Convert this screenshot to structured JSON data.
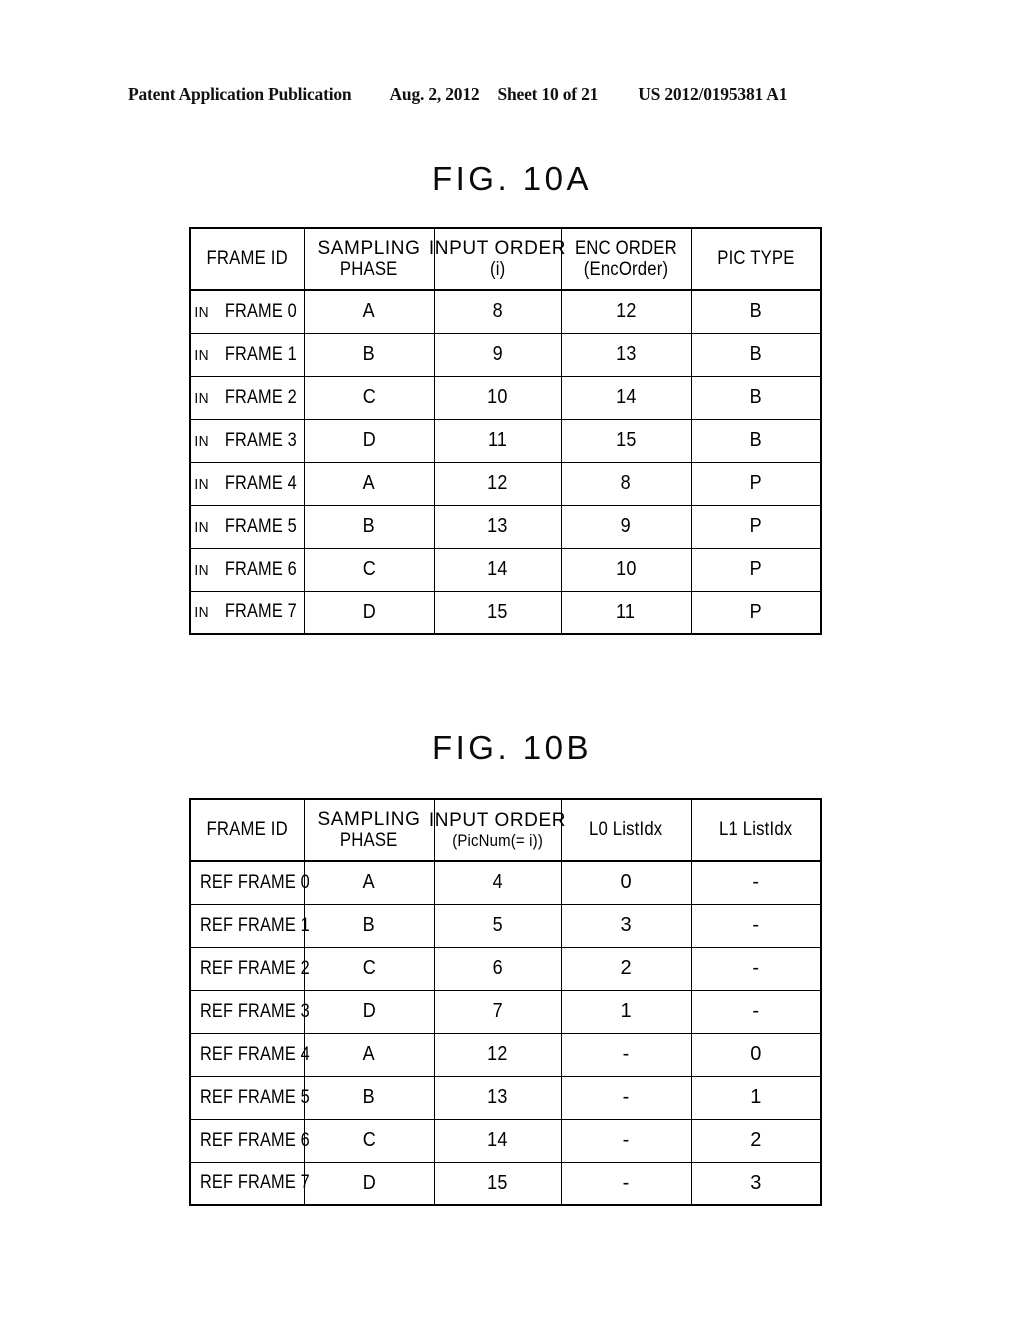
{
  "header": {
    "publication": "Patent Application Publication",
    "date": "Aug. 2, 2012",
    "sheet": "Sheet 10 of 21",
    "doc_number": "US 2012/0195381 A1"
  },
  "figures": [
    {
      "title": "FIG. 10A",
      "columns": [
        {
          "line1": "FRAME ID",
          "line2": ""
        },
        {
          "line1": "SAMPLING",
          "line2": "PHASE"
        },
        {
          "line1": "INPUT  ORDER",
          "line2": "(i)"
        },
        {
          "line1": "ENC ORDER",
          "line2": "(EncOrder)"
        },
        {
          "line1": "PIC TYPE",
          "line2": ""
        }
      ],
      "rows": [
        {
          "prefix": "IN",
          "label": "FRAME 0",
          "phase": "A",
          "input_order": "8",
          "enc_order": "12",
          "pic_type": "B"
        },
        {
          "prefix": "IN",
          "label": "FRAME 1",
          "phase": "B",
          "input_order": "9",
          "enc_order": "13",
          "pic_type": "B"
        },
        {
          "prefix": "IN",
          "label": "FRAME 2",
          "phase": "C",
          "input_order": "10",
          "enc_order": "14",
          "pic_type": "B"
        },
        {
          "prefix": "IN",
          "label": "FRAME 3",
          "phase": "D",
          "input_order": "11",
          "enc_order": "15",
          "pic_type": "B"
        },
        {
          "prefix": "IN",
          "label": "FRAME 4",
          "phase": "A",
          "input_order": "12",
          "enc_order": "8",
          "pic_type": "P"
        },
        {
          "prefix": "IN",
          "label": "FRAME 5",
          "phase": "B",
          "input_order": "13",
          "enc_order": "9",
          "pic_type": "P"
        },
        {
          "prefix": "IN",
          "label": "FRAME 6",
          "phase": "C",
          "input_order": "14",
          "enc_order": "10",
          "pic_type": "P"
        },
        {
          "prefix": "IN",
          "label": "FRAME 7",
          "phase": "D",
          "input_order": "15",
          "enc_order": "11",
          "pic_type": "P"
        }
      ]
    },
    {
      "title": "FIG. 10B",
      "columns": [
        {
          "line1": "FRAME ID",
          "line2": ""
        },
        {
          "line1": "SAMPLING",
          "line2": "PHASE"
        },
        {
          "line1": "INPUT  ORDER",
          "line2": "(PicNum(= i))"
        },
        {
          "line1": "L0 ListIdx",
          "line2": ""
        },
        {
          "line1": "L1 ListIdx",
          "line2": ""
        }
      ],
      "rows": [
        {
          "prefix": "",
          "label": "REF FRAME 0",
          "phase": "A",
          "input_order": "4",
          "l0": "0",
          "l1": "-"
        },
        {
          "prefix": "",
          "label": "REF FRAME 1",
          "phase": "B",
          "input_order": "5",
          "l0": "3",
          "l1": "-"
        },
        {
          "prefix": "",
          "label": "REF FRAME 2",
          "phase": "C",
          "input_order": "6",
          "l0": "2",
          "l1": "-"
        },
        {
          "prefix": "",
          "label": "REF FRAME 3",
          "phase": "D",
          "input_order": "7",
          "l0": "1",
          "l1": "-"
        },
        {
          "prefix": "",
          "label": "REF FRAME 4",
          "phase": "A",
          "input_order": "12",
          "l0": "-",
          "l1": "0"
        },
        {
          "prefix": "",
          "label": "REF FRAME 5",
          "phase": "B",
          "input_order": "13",
          "l0": "-",
          "l1": "1"
        },
        {
          "prefix": "",
          "label": "REF FRAME 6",
          "phase": "C",
          "input_order": "14",
          "l0": "-",
          "l1": "2"
        },
        {
          "prefix": "",
          "label": "REF FRAME 7",
          "phase": "D",
          "input_order": "15",
          "l0": "-",
          "l1": "3"
        }
      ]
    }
  ]
}
